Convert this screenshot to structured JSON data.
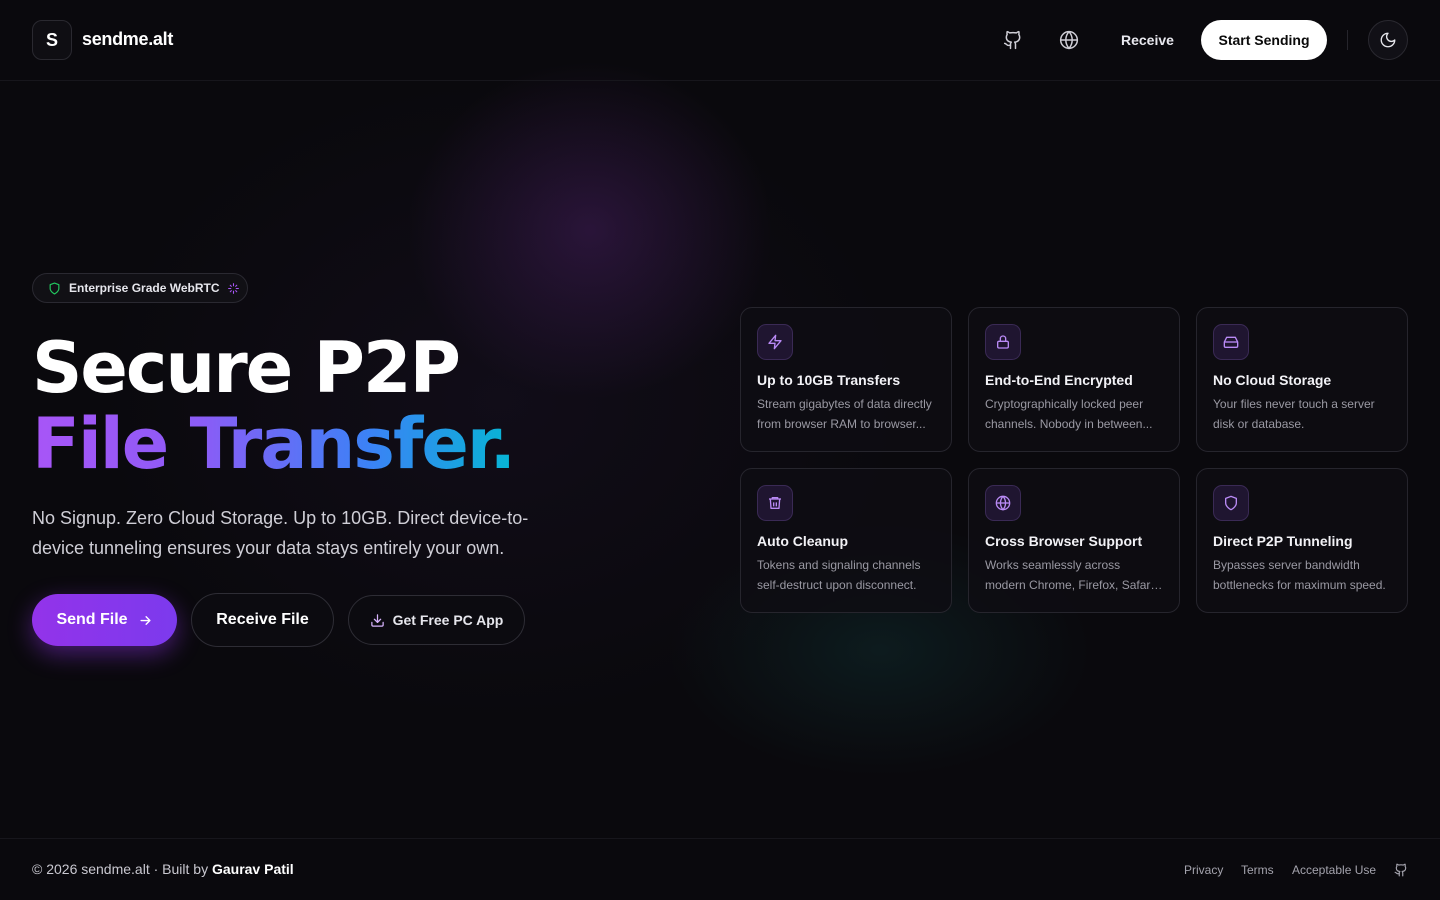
{
  "header": {
    "logo_letter": "S",
    "brand": "sendme.alt",
    "github_icon": "github-icon",
    "language_icon": "globe-icon",
    "receive_label": "Receive",
    "start_label": "Start Sending",
    "theme_icon": "moon-icon"
  },
  "hero": {
    "badge": "Enterprise Grade WebRTC",
    "title_line1": "Secure P2P",
    "title_line2": "File Transfer.",
    "subtitle": "No Signup. Zero Cloud Storage. Up to 10GB. Direct device-to-device tunneling ensures your data stays entirely your own.",
    "send_label": "Send File",
    "receive_label": "Receive File",
    "app_label": "Get Free PC App"
  },
  "features": [
    {
      "icon": "bolt-icon",
      "title": "Up to 10GB Transfers",
      "desc": "Stream gigabytes of data directly from browser RAM to browser..."
    },
    {
      "icon": "lock-icon",
      "title": "End-to-End Encrypted",
      "desc": "Cryptographically locked peer channels. Nobody in between..."
    },
    {
      "icon": "hard-drive-icon",
      "title": "No Cloud Storage",
      "desc": "Your files never touch a server disk or database."
    },
    {
      "icon": "trash-icon",
      "title": "Auto Cleanup",
      "desc": "Tokens and signaling channels self-destruct upon disconnect."
    },
    {
      "icon": "globe-icon",
      "title": "Cross Browser Support",
      "desc": "Works seamlessly across modern Chrome, Firefox, Safari, Edge, &..."
    },
    {
      "icon": "shield-icon",
      "title": "Direct P2P Tunneling",
      "desc": "Bypasses server bandwidth bottlenecks for maximum speed."
    }
  ],
  "footer": {
    "copyright_prefix": "© 2026 sendme.alt · Built by ",
    "author": "Gaurav Patil",
    "links": [
      "Privacy",
      "Terms",
      "Acceptable Use"
    ]
  },
  "colors": {
    "background": "#0a090d",
    "accent_purple": "#9333ea",
    "gradient_start": "#a855f7",
    "gradient_end": "#06b6d4",
    "badge_shield": "#22c55e"
  }
}
